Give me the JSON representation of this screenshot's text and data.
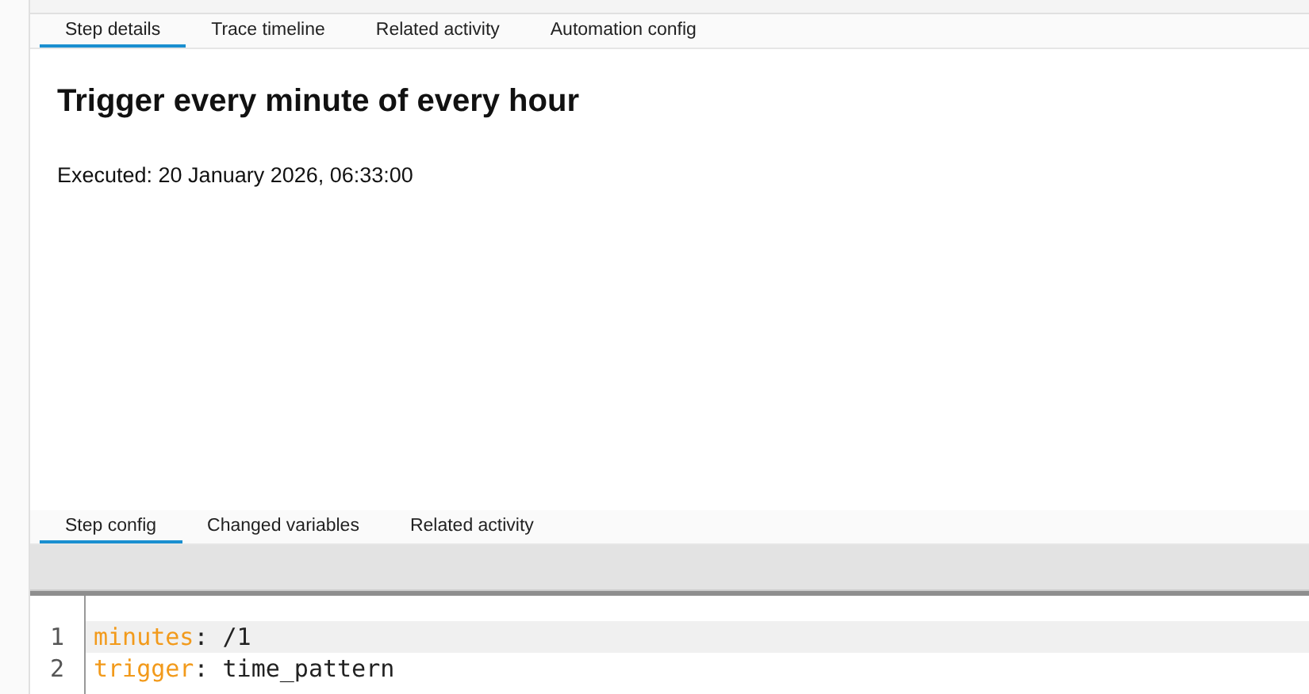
{
  "tabs": [
    {
      "label": "Step details",
      "selected": true
    },
    {
      "label": "Trace timeline",
      "selected": false
    },
    {
      "label": "Related activity",
      "selected": false
    },
    {
      "label": "Automation config",
      "selected": false
    }
  ],
  "step": {
    "title": "Trigger every minute of every hour",
    "executed": "Executed: 20 January 2026, 06:33:00"
  },
  "config_tabs": [
    {
      "label": "Step config",
      "selected": true
    },
    {
      "label": "Changed variables",
      "selected": false
    },
    {
      "label": "Related activity",
      "selected": false
    }
  ],
  "editor": {
    "lines": [
      {
        "number": "1",
        "key": "minutes",
        "separator": ":",
        "value": "/1",
        "active": true
      },
      {
        "number": "2",
        "key": "trigger",
        "separator": ":",
        "value": "time_pattern",
        "active": false
      }
    ]
  }
}
